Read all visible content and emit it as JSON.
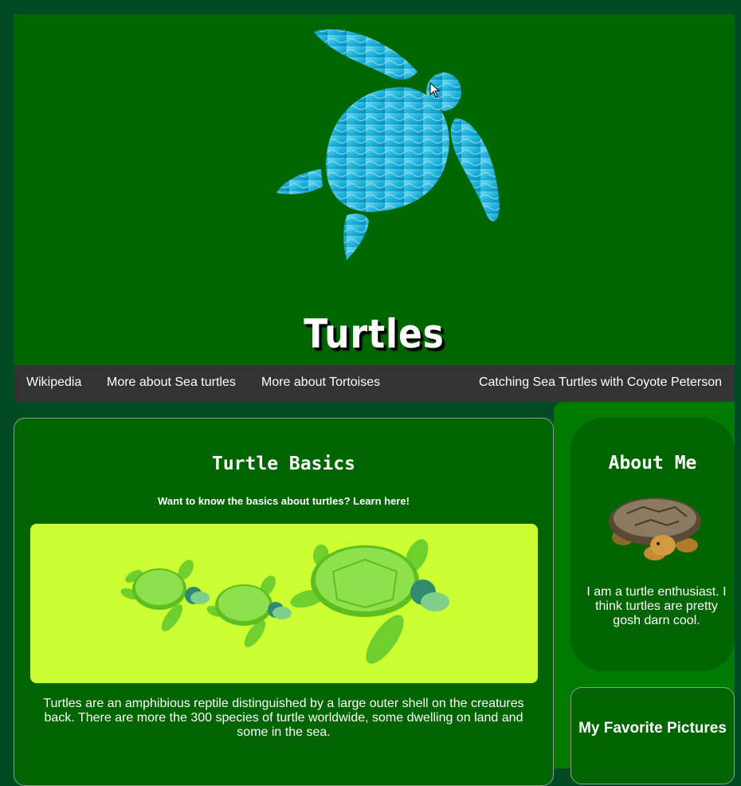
{
  "header": {
    "title": "Turtles"
  },
  "nav": {
    "links": [
      "Wikipedia",
      "More about Sea turtles",
      "More about Tortoises"
    ],
    "right_link": "Catching Sea Turtles with Coyote Peterson"
  },
  "main": {
    "title": "Turtle Basics",
    "subtitle": "Want to know the basics about turtles? Learn here!",
    "paragraph": "Turtles are an amphibious reptile distinguished by a large outer shell on the creatures back. There are more the 300 species of turtle worldwide, some dwelling on land and some in the sea."
  },
  "sidebar": {
    "about": {
      "title": "About Me",
      "text": "I am a turtle enthusiast. I think turtles are pretty gosh darn cool."
    },
    "favorites": {
      "title": "My Favorite Pictures"
    }
  },
  "colors": {
    "page_bg": "#014a24",
    "header_bg": "#006600",
    "nav_bg": "#333333",
    "card_bg": "#006400",
    "sidebar_bg": "#007a00",
    "hero_bg": "#ccff33"
  }
}
